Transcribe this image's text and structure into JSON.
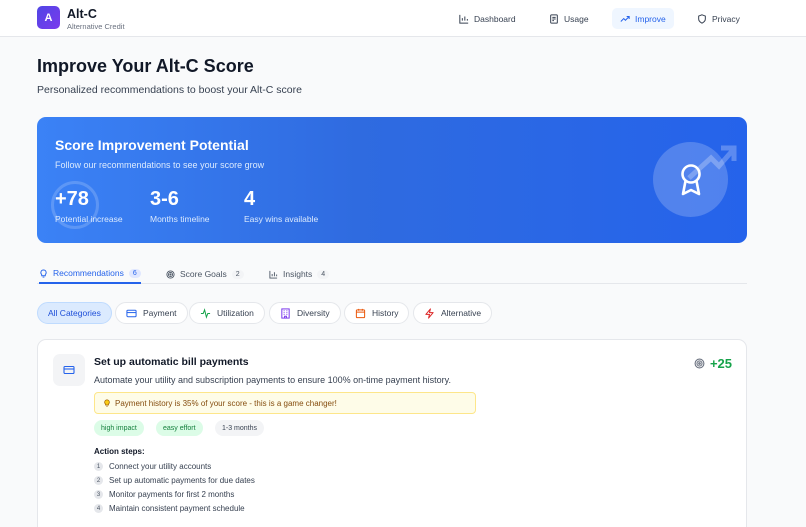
{
  "header": {
    "logo_letter": "A",
    "app_name": "Alt-C",
    "app_subtitle": "Alternative Credit",
    "nav": [
      {
        "label": "Dashboard",
        "icon": "bar-chart-icon"
      },
      {
        "label": "Usage",
        "icon": "receipt-icon"
      },
      {
        "label": "Improve",
        "icon": "trending-up-icon",
        "active": true
      },
      {
        "label": "Privacy",
        "icon": "shield-icon"
      }
    ]
  },
  "page": {
    "title": "Improve Your Alt-C Score",
    "subtitle": "Personalized recommendations to boost your Alt-C score"
  },
  "hero": {
    "title": "Score Improvement Potential",
    "subtitle": "Follow our recommendations to see your score grow",
    "stats": [
      {
        "value": "+78",
        "label": "Potential increase"
      },
      {
        "value": "3-6",
        "label": "Months timeline"
      },
      {
        "value": "4",
        "label": "Easy wins available"
      }
    ],
    "badge_icon": "award-icon"
  },
  "tabs": [
    {
      "label": "Recommendations",
      "count": "6",
      "icon": "lightbulb-icon",
      "active": true
    },
    {
      "label": "Score Goals",
      "count": "2",
      "icon": "target-icon"
    },
    {
      "label": "Insights",
      "count": "4",
      "icon": "bar-chart-icon"
    }
  ],
  "categories": [
    {
      "label": "All Categories",
      "active": true
    },
    {
      "label": "Payment",
      "icon": "credit-card-icon"
    },
    {
      "label": "Utilization",
      "icon": "activity-icon"
    },
    {
      "label": "Diversity",
      "icon": "building-icon"
    },
    {
      "label": "History",
      "icon": "calendar-icon"
    },
    {
      "label": "Alternative",
      "icon": "zap-icon"
    }
  ],
  "recommendation": {
    "title": "Set up automatic bill payments",
    "description": "Automate your utility and subscription payments to ensure 100% on-time payment history.",
    "points": "+25",
    "tip": "Payment history is 35% of your score - this is a game changer!",
    "tags": [
      "high impact",
      "easy effort",
      "1-3 months"
    ],
    "steps_label": "Action steps:",
    "steps": [
      {
        "num": "1",
        "text": "Connect your utility accounts"
      },
      {
        "num": "2",
        "text": "Set up automatic payments for due dates"
      },
      {
        "num": "3",
        "text": "Monitor payments for first 2 months"
      },
      {
        "num": "4",
        "text": "Maintain consistent payment schedule"
      }
    ]
  },
  "colors": {
    "accent": "#2563eb",
    "hero_gradient_start": "#3b82f6",
    "success": "#16a34a",
    "tip_bg": "#fefce8"
  }
}
